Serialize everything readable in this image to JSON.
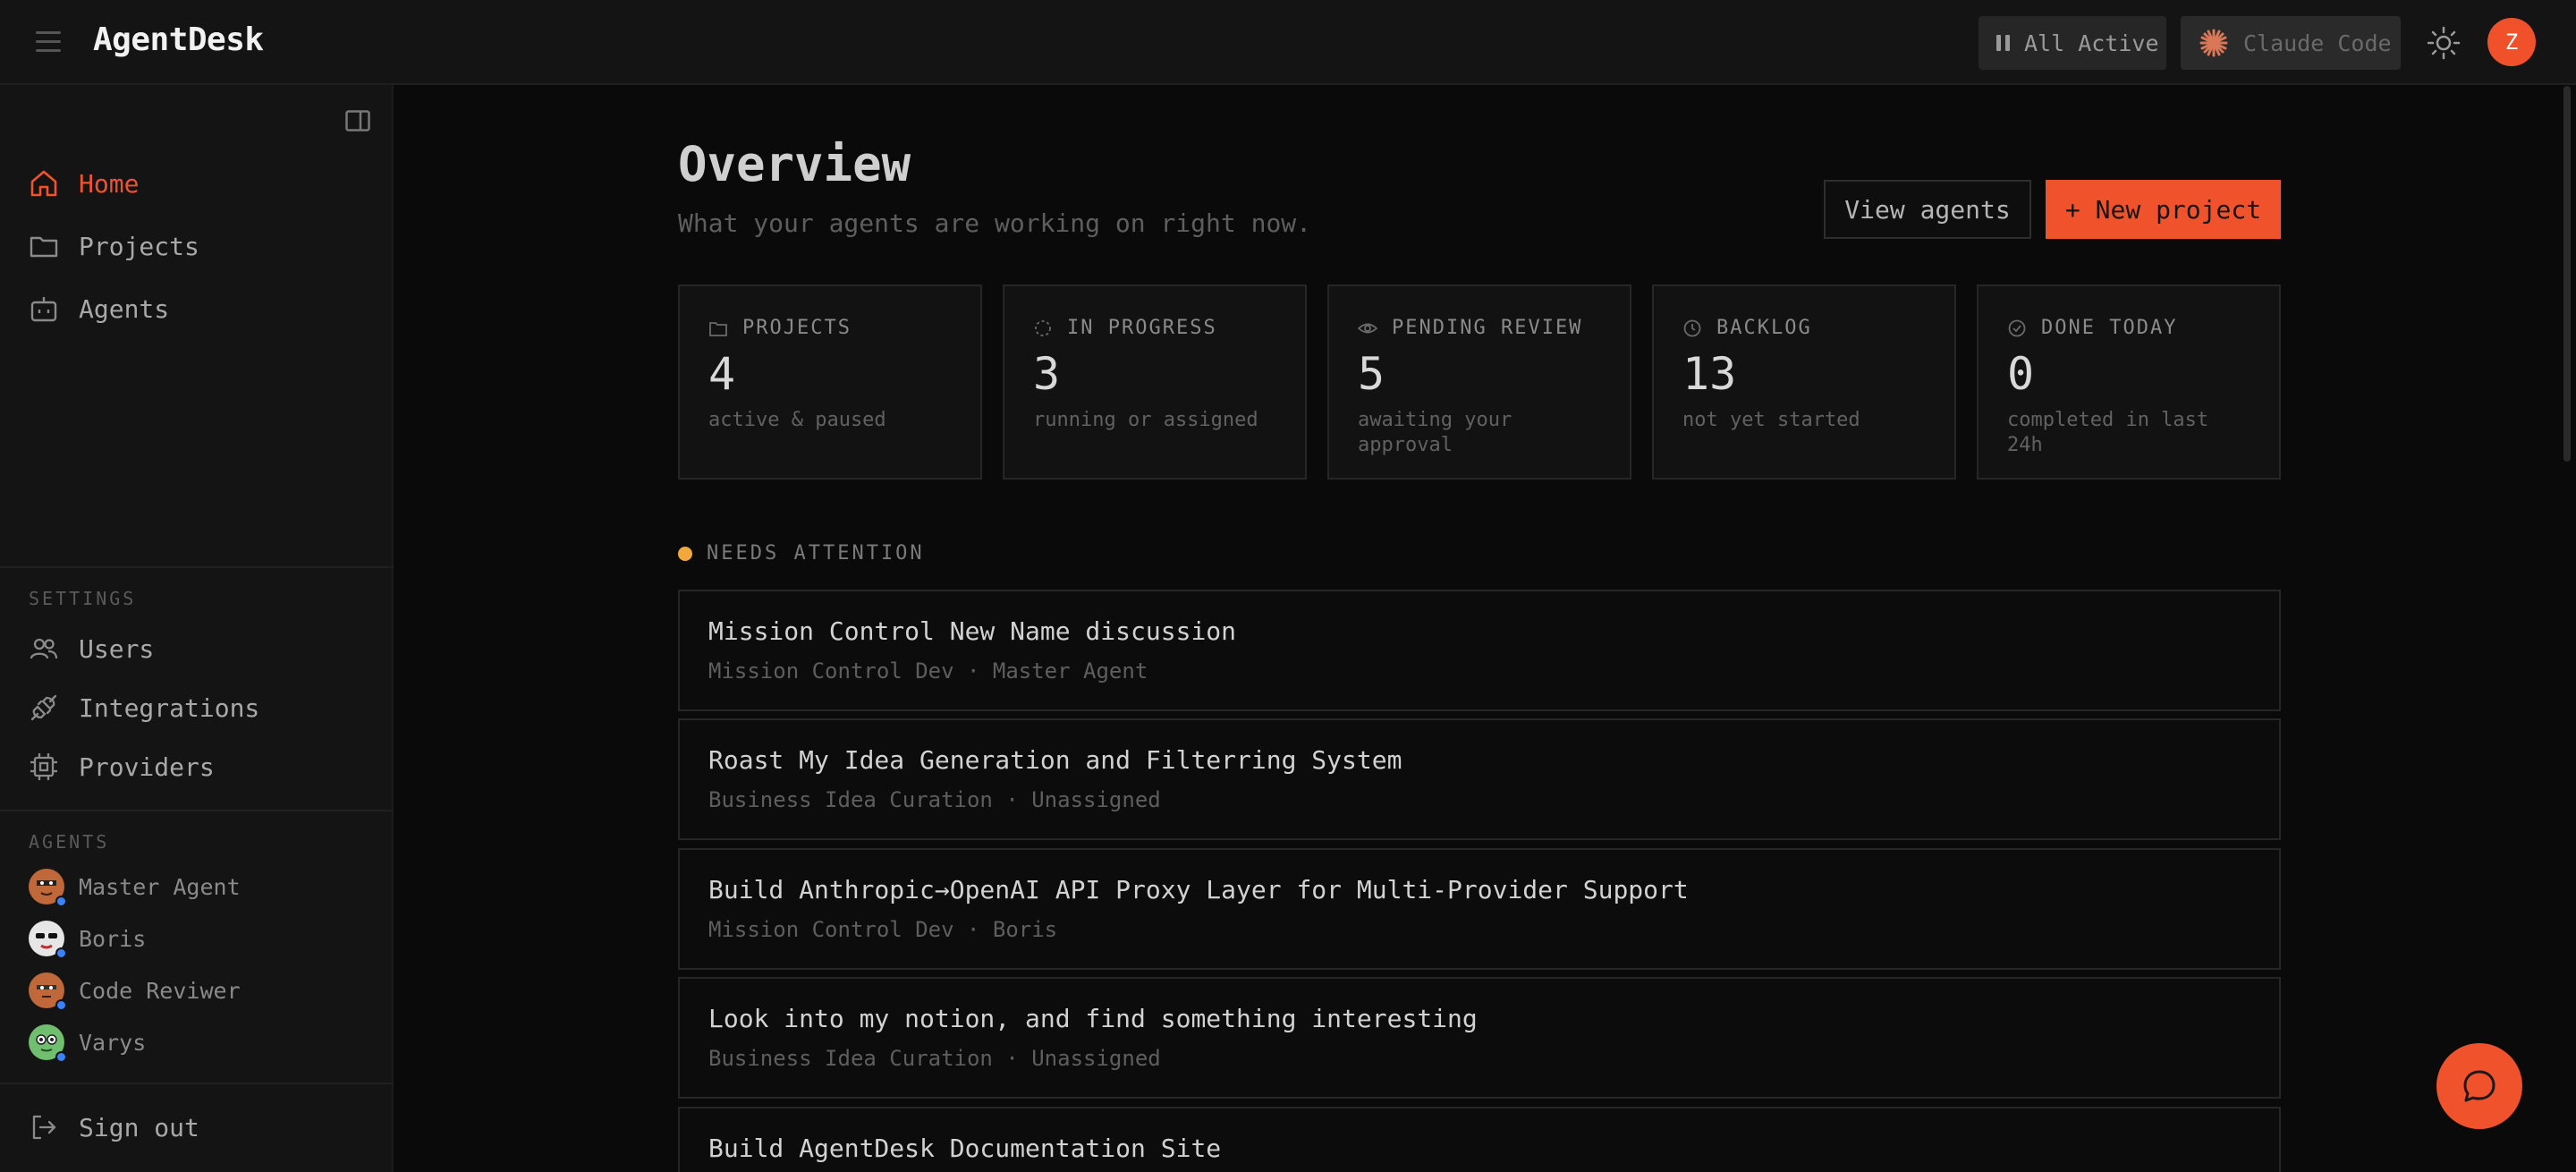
{
  "app": {
    "title": "AgentDesk"
  },
  "topbar": {
    "status_label": "All Active",
    "provider_label": "Claude Code",
    "user_initial": "Z"
  },
  "sidebar": {
    "nav": [
      {
        "label": "Home",
        "icon": "home-icon",
        "active": true
      },
      {
        "label": "Projects",
        "icon": "folder-icon"
      },
      {
        "label": "Agents",
        "icon": "bot-icon"
      }
    ],
    "settings_label": "SETTINGS",
    "settings": [
      {
        "label": "Users",
        "icon": "users-icon"
      },
      {
        "label": "Integrations",
        "icon": "plug-icon"
      },
      {
        "label": "Providers",
        "icon": "chip-icon"
      }
    ],
    "agents_label": "AGENTS",
    "agents": [
      {
        "name": "Master Agent",
        "color": "#c0683a"
      },
      {
        "name": "Boris",
        "color": "#e0e0e0"
      },
      {
        "name": "Code Reviwer",
        "color": "#c0683a"
      },
      {
        "name": "Varys",
        "color": "#6fbf6f"
      }
    ],
    "sign_out": "Sign out"
  },
  "main": {
    "title": "Overview",
    "subtitle": "What your agents are working on right now.",
    "view_agents": "View agents",
    "new_project": "+ New project",
    "stats": [
      {
        "label": "PROJECTS",
        "value": "4",
        "sub": "active & paused",
        "icon": "folder-icon"
      },
      {
        "label": "IN PROGRESS",
        "value": "3",
        "sub": "running or assigned",
        "icon": "spinner-icon"
      },
      {
        "label": "PENDING REVIEW",
        "value": "5",
        "sub": "awaiting your approval",
        "icon": "eye-icon"
      },
      {
        "label": "BACKLOG",
        "value": "13",
        "sub": "not yet started",
        "icon": "clock-icon"
      },
      {
        "label": "DONE TODAY",
        "value": "0",
        "sub": "completed in last 24h",
        "icon": "check-circle-icon"
      }
    ],
    "attention_label": "NEEDS ATTENTION",
    "tasks": [
      {
        "title": "Mission Control New Name discussion",
        "meta": "Mission Control Dev · Master Agent"
      },
      {
        "title": "Roast My Idea Generation and Filterring System",
        "meta": "Business Idea Curation · Unassigned"
      },
      {
        "title": "Build Anthropic→OpenAI API Proxy Layer for Multi-Provider Support",
        "meta": "Mission Control Dev · Boris"
      },
      {
        "title": "Look into my notion, and find something interesting",
        "meta": "Business Idea Curation · Unassigned"
      },
      {
        "title": "Build AgentDesk Documentation Site",
        "meta": ""
      }
    ]
  },
  "colors": {
    "accent": "#f0532b",
    "attention": "#f2a93b",
    "online": "#3b82f6"
  }
}
